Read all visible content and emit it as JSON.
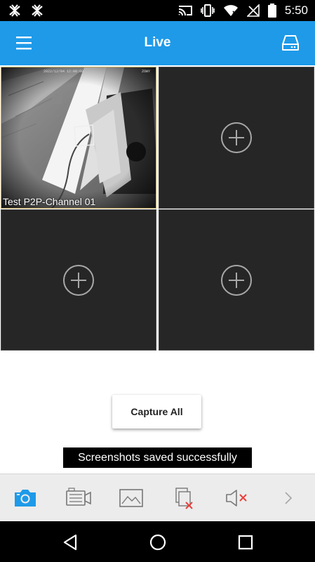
{
  "status_bar": {
    "time": "5:50",
    "left_icons": [
      "app-notification-icon",
      "app-notification-icon"
    ],
    "right_icons": [
      "cast-icon",
      "vibrate-icon",
      "wifi-icon",
      "no-signal-icon",
      "battery-icon"
    ]
  },
  "app_bar": {
    "title": "Live",
    "menu_icon": "hamburger-menu-icon",
    "right_icon": "hard-drive-icon"
  },
  "grid": {
    "cells": [
      {
        "label": "Test P2P-Channel 01",
        "state": "playing",
        "overlay_timestamp": "2022/12/04 12:00:00",
        "overlay_brand": "ZOWY"
      },
      {
        "label": "",
        "state": "empty"
      },
      {
        "label": "",
        "state": "empty"
      },
      {
        "label": "",
        "state": "empty"
      }
    ]
  },
  "capture_all_label": "Capture All",
  "toast_text": "Screenshots saved successfully",
  "toolbar": {
    "items": [
      {
        "name": "snapshot",
        "icon": "camera-icon",
        "active": true
      },
      {
        "name": "record",
        "icon": "video-record-icon",
        "active": false
      },
      {
        "name": "picture",
        "icon": "image-icon",
        "active": false
      },
      {
        "name": "close-all",
        "icon": "close-windows-icon",
        "active": false
      },
      {
        "name": "audio",
        "icon": "speaker-muted-icon",
        "active": false
      },
      {
        "name": "more",
        "icon": "chevron-right-icon",
        "active": false
      }
    ]
  },
  "colors": {
    "accent": "#1e9ae9",
    "cell_bg": "#262626",
    "cell_border_active": "#c8a85a",
    "toolbar_bg": "#ececec",
    "mute_x": "#e8413a"
  }
}
